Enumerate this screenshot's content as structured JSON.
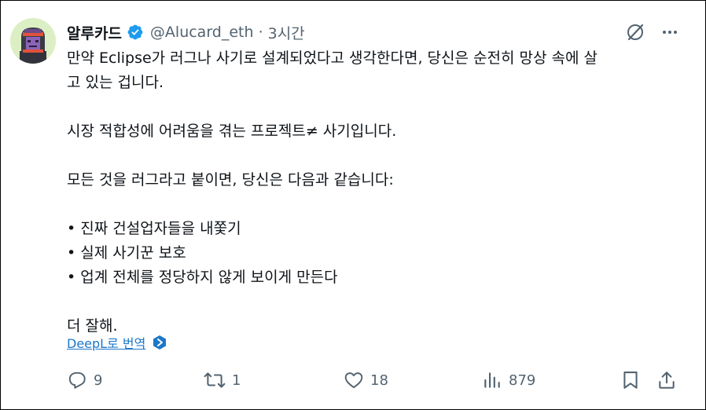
{
  "author": {
    "name": "알루카드",
    "handle": "@Alucard_eth",
    "separator": "·",
    "time": "3시간"
  },
  "tweet": {
    "lines": [
      "만약 Eclipse가 러그나 사기로 설계되었다고 생각한다면, 당신은 순전히 망상 속에 살",
      "고 있는 겁니다.",
      "",
      "시장 적합성에 어려움을 겪는 프로젝트≠ 사기입니다.",
      "",
      "모든 것을 러그라고 붙이면, 당신은 다음과 같습니다:",
      "",
      "• 진짜 건설업자들을 내쫓기",
      "• 실제 사기꾼 보호",
      "• 업계 전체를 정당하지 않게 보이게 만든다",
      "",
      "더 잘해."
    ]
  },
  "translate": {
    "label": "DeepL로 번역"
  },
  "actions": {
    "reply_count": "9",
    "retweet_count": "1",
    "like_count": "18",
    "views_count": "879"
  },
  "icons": {
    "verified": "verified-badge-icon",
    "grok": "grok-icon",
    "more": "more-icon",
    "reply": "reply-icon",
    "retweet": "retweet-icon",
    "like": "heart-icon",
    "views": "views-icon",
    "bookmark": "bookmark-icon",
    "share": "share-icon",
    "deepl": "deepl-icon"
  },
  "colors": {
    "text": "#0f1419",
    "muted": "#536471",
    "link": "#1d77c9",
    "verified": "#1d9bf0",
    "deepl": "#0f2b46"
  }
}
